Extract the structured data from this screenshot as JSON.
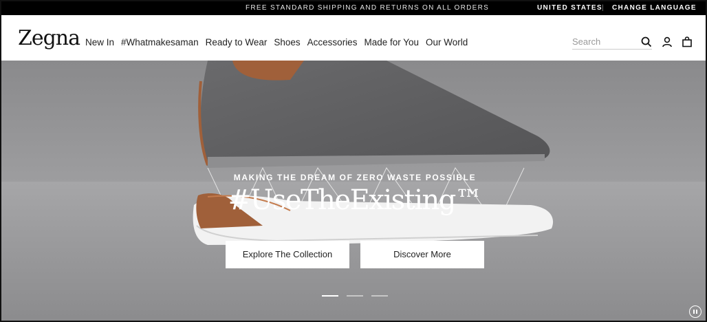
{
  "topbar": {
    "promo": "FREE STANDARD SHIPPING AND RETURNS ON ALL ORDERS",
    "country": "UNITED STATES",
    "separator": "|",
    "language": "CHANGE LANGUAGE"
  },
  "header": {
    "logo": "Zegna",
    "nav": [
      "New In",
      "#Whatmakesaman",
      "Ready to Wear",
      "Shoes",
      "Accessories",
      "Made for You",
      "Our World"
    ],
    "search_placeholder": "Search",
    "icons": [
      "search-icon",
      "user-icon",
      "bag-icon"
    ]
  },
  "hero": {
    "kicker": "MAKING THE DREAM OF ZERO WASTE POSSIBLE",
    "headline": "#UseTheExisting™",
    "buttons": [
      "Explore The Collection",
      "Discover More"
    ],
    "slides_total": 3,
    "active_slide": 1
  },
  "colors": {
    "topbar": "#000000",
    "hero_background": "#9a9a9c",
    "shoe_upper": "#5e5e60",
    "leather_accent": "#a0603a",
    "sole": "#f2f2f2"
  }
}
